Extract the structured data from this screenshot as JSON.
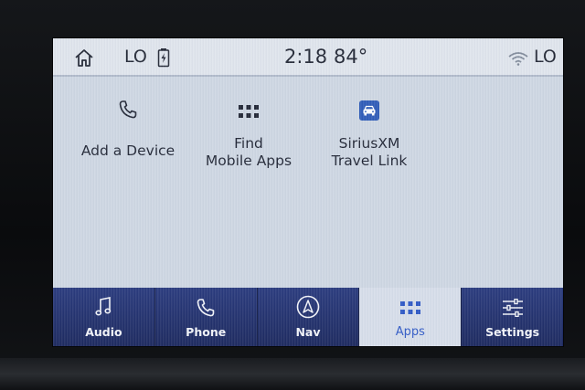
{
  "status_bar": {
    "left_fan": "LO",
    "time": "2:18",
    "temperature": "84°",
    "right_fan": "LO"
  },
  "apps": [
    {
      "label_line1": "Add a Device",
      "label_line2": "",
      "icon": "phone-icon"
    },
    {
      "label_line1": "Find",
      "label_line2": "Mobile Apps",
      "icon": "grid-icon"
    },
    {
      "label_line1": "SiriusXM",
      "label_line2": "Travel Link",
      "icon": "car-icon"
    }
  ],
  "nav": [
    {
      "label": "Audio",
      "icon": "music-note-icon"
    },
    {
      "label": "Phone",
      "icon": "phone-icon"
    },
    {
      "label": "Nav",
      "icon": "compass-arrow-icon"
    },
    {
      "label": "Apps",
      "icon": "grid-icon",
      "active": true
    },
    {
      "label": "Settings",
      "icon": "sliders-icon"
    }
  ],
  "colors": {
    "nav_bg": "#1c2b66",
    "active_tab_bg": "#d6dde9",
    "active_tab_text": "#2a55c4",
    "screen_bg": "#cdd6e2",
    "siriusxm_badge": "#2a58b6"
  }
}
